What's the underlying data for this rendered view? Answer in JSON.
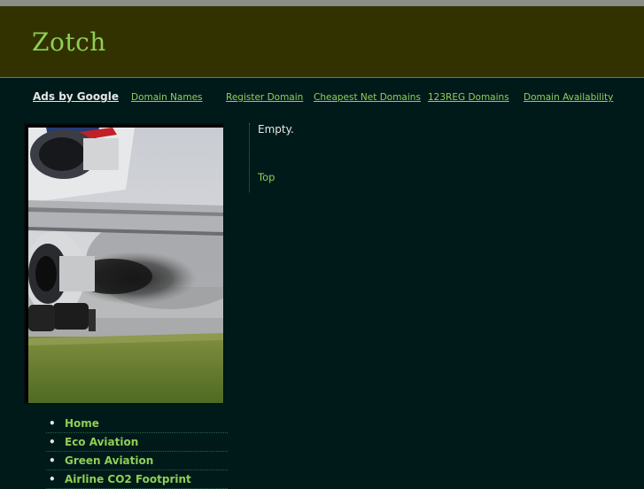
{
  "site": {
    "title": "Zotch"
  },
  "ads": {
    "label": "Ads by Google",
    "links": [
      "Domain Names",
      "Register Domain",
      "Cheapest Net Domains",
      "123REG Domains",
      "Domain Availability"
    ]
  },
  "nav": {
    "items": [
      "Home",
      "Eco Aviation",
      "Green Aviation",
      "Airline CO2 Footprint"
    ]
  },
  "content": {
    "text": "Empty.",
    "top_link": "Top"
  },
  "colors": {
    "header_bg": "#323200",
    "page_bg": "#001a1a",
    "link": "#8fcf55",
    "text": "#e8e8e8"
  }
}
